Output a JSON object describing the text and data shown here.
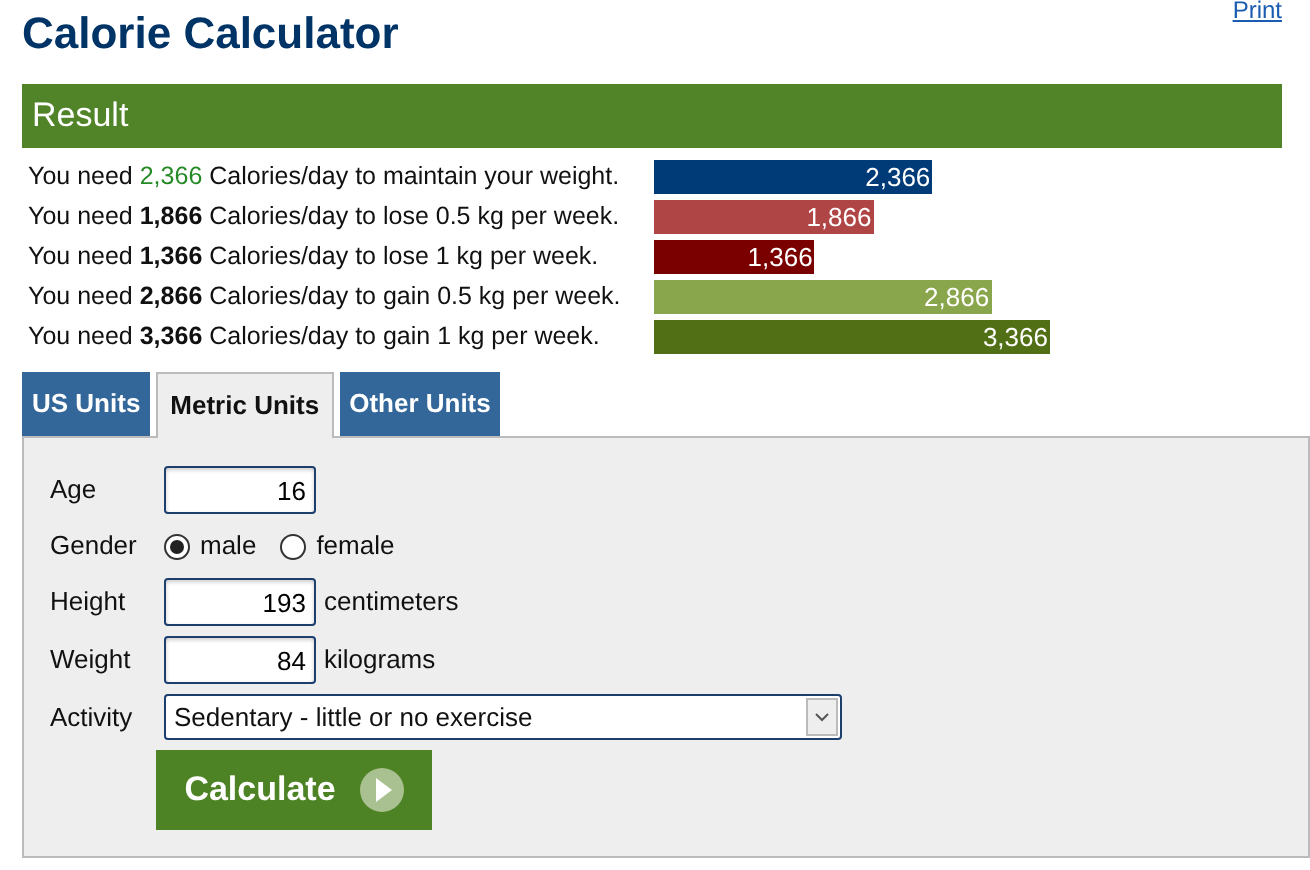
{
  "header": {
    "title": "Calorie Calculator",
    "print_link": "Print"
  },
  "result": {
    "title": "Result",
    "rows": [
      {
        "before": "You need ",
        "amount": "2,366",
        "after": " Calories/day to maintain your weight.",
        "highlighted": true,
        "bar_label": "2,366",
        "color": "#003a77"
      },
      {
        "before": "You need ",
        "amount": "1,866",
        "after": " Calories/day to lose 0.5 kg per week.",
        "highlighted": false,
        "bar_label": "1,866",
        "color": "#b04545"
      },
      {
        "before": "You need ",
        "amount": "1,366",
        "after": " Calories/day to lose 1 kg per week.",
        "highlighted": false,
        "bar_label": "1,366",
        "color": "#7a0000"
      },
      {
        "before": "You need ",
        "amount": "2,866",
        "after": " Calories/day to gain 0.5 kg per week.",
        "highlighted": false,
        "bar_label": "2,866",
        "color": "#8aa64c"
      },
      {
        "before": "You need ",
        "amount": "3,366",
        "after": " Calories/day to gain 1 kg per week.",
        "highlighted": false,
        "bar_label": "3,366",
        "color": "#516f14"
      }
    ]
  },
  "tabs": [
    {
      "label": "US Units",
      "selected": false
    },
    {
      "label": "Metric Units",
      "selected": true
    },
    {
      "label": "Other Units",
      "selected": false
    }
  ],
  "form": {
    "age": {
      "label": "Age",
      "value": "16"
    },
    "gender": {
      "label": "Gender",
      "options": [
        {
          "label": "male",
          "selected": true
        },
        {
          "label": "female",
          "selected": false
        }
      ]
    },
    "height": {
      "label": "Height",
      "value": "193",
      "unit": "centimeters"
    },
    "weight": {
      "label": "Weight",
      "value": "84",
      "unit": "kilograms"
    },
    "activity": {
      "label": "Activity",
      "value": "Sedentary - little or no exercise"
    },
    "button": "Calculate"
  }
}
